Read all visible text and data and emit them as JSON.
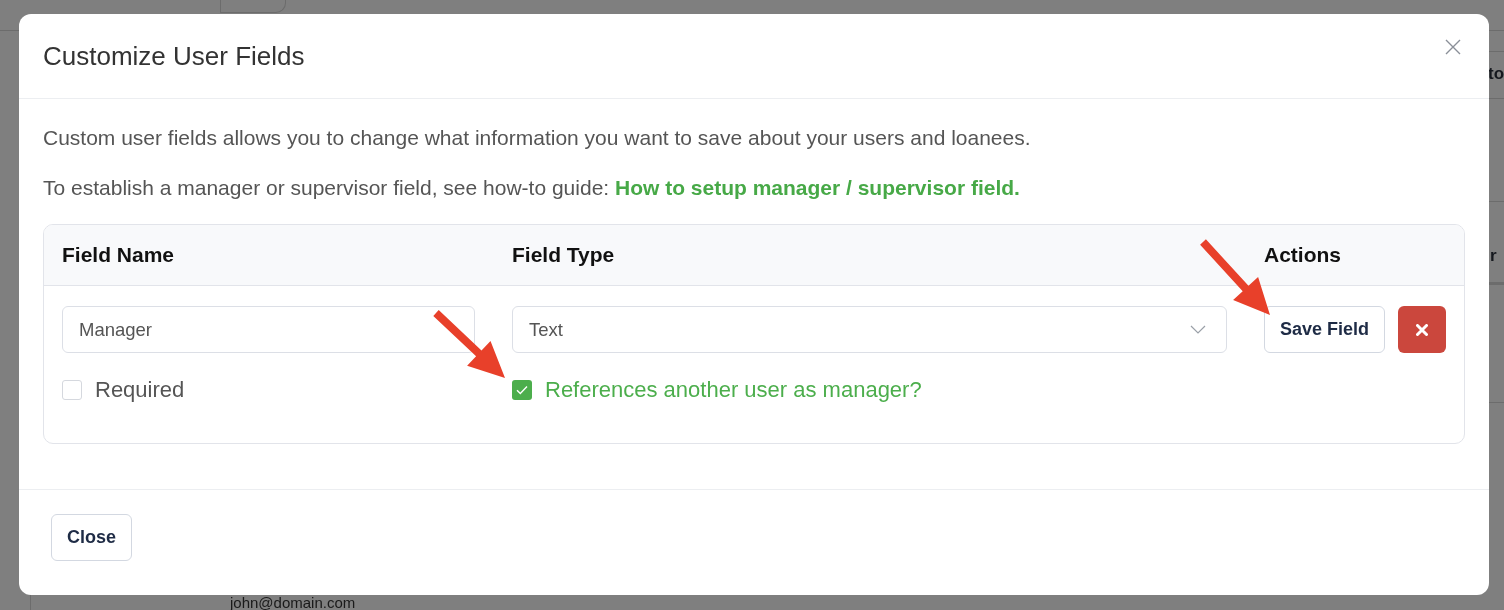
{
  "background": {
    "fragments": [
      "to",
      "r"
    ],
    "email": "john@domain.com"
  },
  "dialog": {
    "title": "Customize User Fields",
    "description": "Custom user fields allows you to change what information you want to save about your users and loanees.",
    "guide": {
      "text": "To establish a manager or supervisor field, see how-to guide:",
      "link": "How to setup manager / supervisor field."
    },
    "table": {
      "columns": [
        "Field Name",
        "Field Type",
        "Actions"
      ],
      "rows": [
        {
          "field_name": "Manager",
          "field_type": "Text",
          "save_button": "Save Field",
          "required": {
            "label": "Required",
            "checked": false
          },
          "references_manager": {
            "label": "References another user as manager?",
            "checked": true
          }
        }
      ]
    },
    "footer_buttons": [
      "Close"
    ]
  }
}
